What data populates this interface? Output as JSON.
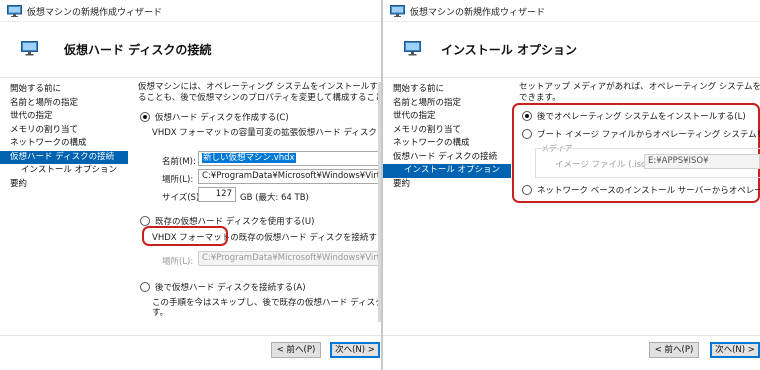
{
  "left": {
    "window_title": "仮想マシンの新規作成ウィザード",
    "page_title": "仮想ハード ディスクの接続",
    "nav": [
      {
        "label": "開始する前に",
        "sub": false,
        "active": false
      },
      {
        "label": "名前と場所の指定",
        "sub": false,
        "active": false
      },
      {
        "label": "世代の指定",
        "sub": false,
        "active": false
      },
      {
        "label": "メモリの割り当て",
        "sub": false,
        "active": false
      },
      {
        "label": "ネットワークの構成",
        "sub": false,
        "active": false
      },
      {
        "label": "仮想ハード ディスクの接続",
        "sub": false,
        "active": true
      },
      {
        "label": "インストール オプション",
        "sub": true,
        "active": false
      },
      {
        "label": "要約",
        "sub": false,
        "active": false
      }
    ],
    "intro_line1": "仮想マシンには、オペレーティング システムをインストールするための記憶",
    "intro_line2": "ることも、後で仮想マシンのプロパティを変更して構成することもできます。",
    "opt_create_label": "仮想ハード ディスクを作成する(C)",
    "opt_create_desc": "VHDX フォーマットの容量可変の拡張仮想ハード ディスクを作成す",
    "name_label": "名前(M):",
    "name_value": "新しい仮想マシン.vhdx",
    "location_label": "場所(L):",
    "location_value": "C:¥ProgramData¥Microsoft¥Windows¥Virtual Ha",
    "size_label": "サイズ(S):",
    "size_value": "127",
    "size_unit": "GB (最大: 64 TB)",
    "opt_existing_label": "既存の仮想ハード ディスクを使用する(U)",
    "opt_existing_desc": "VHDX フォーマットの既存の仮想ハード ディスクを接続するには、こ",
    "existing_location_label": "場所(L):",
    "existing_location_value": "C:¥ProgramData¥Microsoft¥Windows¥Virtual Ha",
    "opt_later_label": "後で仮想ハード ディスクを接続する(A)",
    "opt_later_desc1": "この手順を今はスキップし、後で既存の仮想ハード ディスクを接続",
    "opt_later_desc2": "す。",
    "back_button": "< 前へ(P)",
    "next_button": "次へ(N) >"
  },
  "right": {
    "window_title": "仮想マシンの新規作成ウィザード",
    "page_title": "インストール オプション",
    "nav": [
      {
        "label": "開始する前に",
        "sub": false,
        "active": false
      },
      {
        "label": "名前と場所の指定",
        "sub": false,
        "active": false
      },
      {
        "label": "世代の指定",
        "sub": false,
        "active": false
      },
      {
        "label": "メモリの割り当て",
        "sub": false,
        "active": false
      },
      {
        "label": "ネットワークの構成",
        "sub": false,
        "active": false
      },
      {
        "label": "仮想ハード ディスクの接続",
        "sub": false,
        "active": false
      },
      {
        "label": "インストール オプション",
        "sub": true,
        "active": true
      },
      {
        "label": "要約",
        "sub": false,
        "active": false
      }
    ],
    "intro_line1": "セットアップ メディアがあれば、オペレーティング システムを今インストール",
    "intro_line2": "できます。",
    "opt_later_label": "後でオペレーティング システムをインストールする(L)",
    "opt_boot_label": "ブート イメージ ファイルからオペレーティング システムをインストールす",
    "media_label": "メディア",
    "image_file_label": "イメージ ファイル (.iso)(I):",
    "image_file_value": "E:¥APPS¥ISO¥",
    "opt_network_label": "ネットワーク ベースのインストール サーバーからオペレーティング シス",
    "back_button": "< 前へ(P)",
    "next_button": "次へ(N) >"
  },
  "colors": {
    "nav_active": "#0063b1",
    "highlight_box": "#c8201d",
    "selection": "#0078d7"
  }
}
